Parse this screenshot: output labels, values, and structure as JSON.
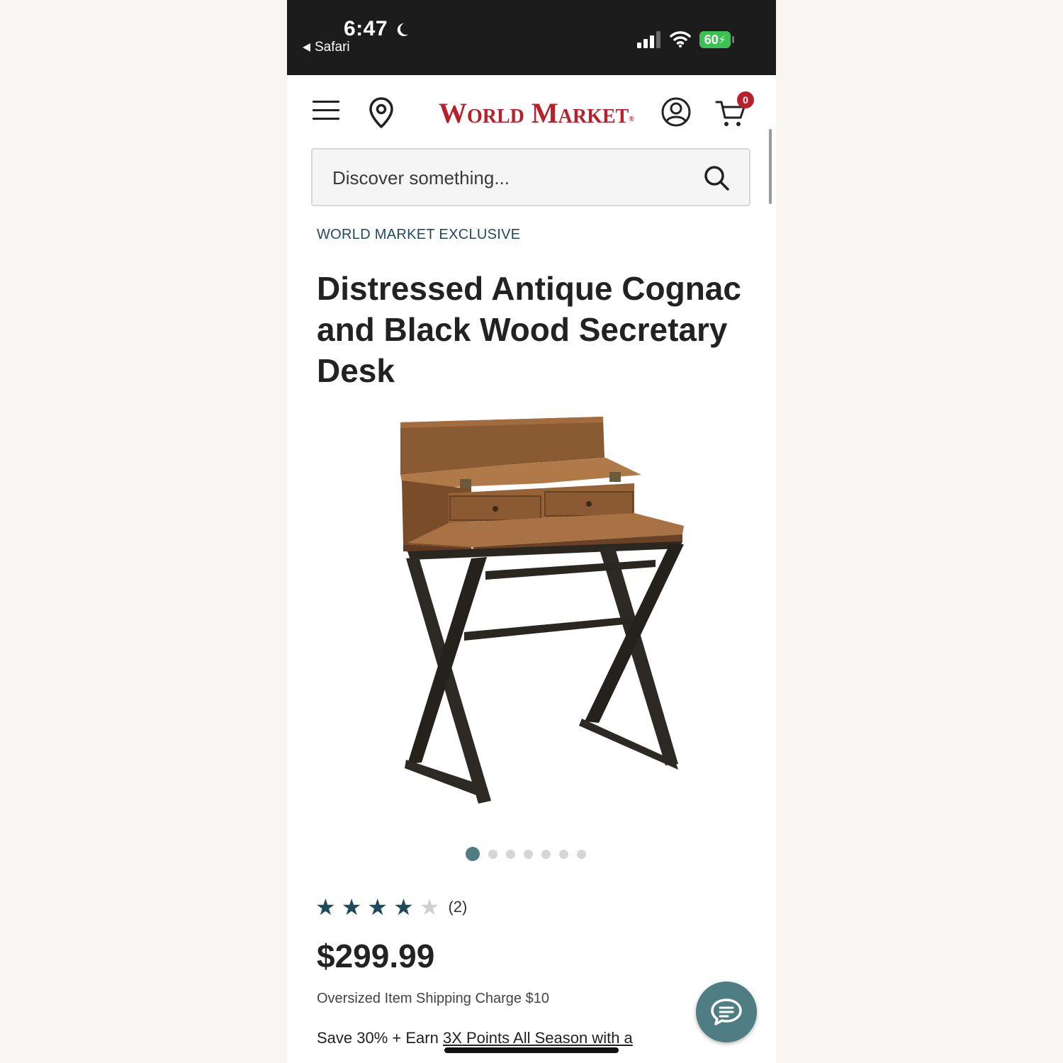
{
  "status_bar": {
    "time": "6:47",
    "back_app": "Safari",
    "battery": "60"
  },
  "header": {
    "logo": "World Market",
    "logo_mark": "®",
    "cart_count": "0"
  },
  "search": {
    "placeholder": "Discover something..."
  },
  "product": {
    "badge": "WORLD MARKET EXCLUSIVE",
    "title": "Distressed Antique Cognac and Black Wood Secretary Desk",
    "image_count": 7,
    "active_image": 1,
    "rating": 4,
    "rating_max": 5,
    "review_count": "(2)",
    "price": "$299.99",
    "shipping_note": "Oversized Item Shipping Charge $10",
    "promo_prefix": "Save 30% + Earn ",
    "promo_link": "3X Points All Season with a"
  },
  "colors": {
    "brand_red": "#b8202b",
    "accent_teal": "#4e7d84",
    "dark_teal": "#1f4a5c"
  },
  "icons": {
    "menu": "hamburger-icon",
    "store": "location-pin-icon",
    "account": "account-icon",
    "cart": "cart-icon",
    "search": "search-icon",
    "chat": "chat-icon"
  }
}
